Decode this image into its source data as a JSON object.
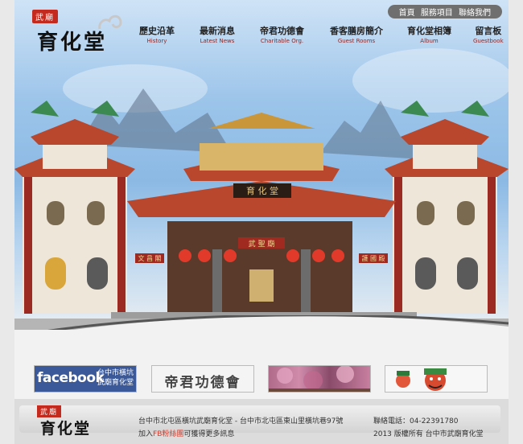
{
  "logo": {
    "seal": "武廟",
    "name": "育化堂"
  },
  "toplinks": [
    "首頁",
    "服務項目",
    "聯絡我們"
  ],
  "nav": [
    {
      "zh": "歷史沿革",
      "en": "History"
    },
    {
      "zh": "最新消息",
      "en": "Latest News"
    },
    {
      "zh": "帝君功德會",
      "en": "Charitable Org."
    },
    {
      "zh": "香客膳房簡介",
      "en": "Guest Rooms"
    },
    {
      "zh": "育化堂相簿",
      "en": "Album"
    },
    {
      "zh": "留言板",
      "en": "Guestbook"
    }
  ],
  "temple": {
    "main_plaque": "育 化 堂",
    "lower_plaque": "武 聖 廟",
    "side_left": "文 昌 閣",
    "side_right": "護 國 殿"
  },
  "banners": {
    "facebook": {
      "brand": "facebook",
      "line1": "台中市橫坑",
      "line2": "武廟育化堂"
    },
    "charity": "帝君功德會"
  },
  "footer": {
    "seal": "武廟",
    "name": "育化堂",
    "address": "台中市北屯區橫坑武廟育化堂 - 台中市北屯區東山里橫坑巷97號",
    "fb_prefix": "加入",
    "fb_link": "FB粉絲團",
    "fb_suffix": "可獲得更多訊息",
    "phone": "聯絡電話：04-22391780",
    "copyright": "2013 版權所有 台中市武廟育化堂"
  },
  "colors": {
    "roof": "#b8472e",
    "pillar": "#9a2a22",
    "wall": "#f0e8dc",
    "facebook": "#3b5998",
    "seal": "#c52a1e"
  }
}
